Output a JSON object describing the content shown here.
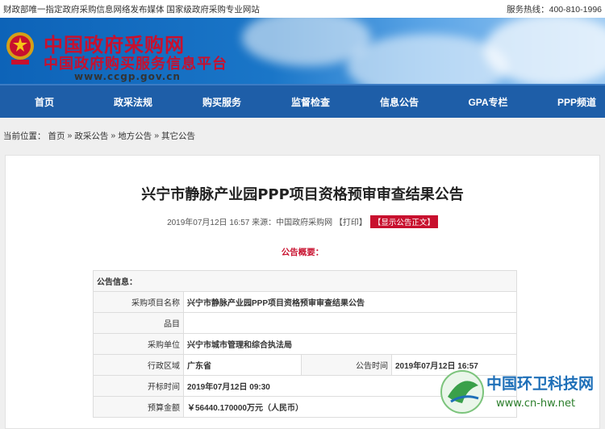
{
  "topbar": {
    "left": "财政部唯一指定政府采购信息网络发布媒体 国家级政府采购专业网站",
    "right": "服务热线：400-810-1996"
  },
  "banner": {
    "line1": "中国政府采购网",
    "line2": "中国政府购买服务信息平台",
    "url": "www.ccgp.gov.cn"
  },
  "nav": [
    "首页",
    "政采法规",
    "购买服务",
    "监督检查",
    "信息公告",
    "GPA专栏",
    "PPP频道"
  ],
  "crumbs": {
    "prefix": "当前位置：",
    "items": [
      "首页",
      "政采公告",
      "地方公告",
      "其它公告"
    ],
    "sep": "»"
  },
  "article": {
    "title": "兴宁市静脉产业园PPP项目资格预审审查结果公告",
    "meta": "2019年07月12日 16:57 来源：中国政府采购网 【打印】",
    "show_body": "【显示公告正文】",
    "summary": "公告概要："
  },
  "table": {
    "header": "公告信息：",
    "rows": [
      {
        "label": "采购项目名称",
        "value": "兴宁市静脉产业园PPP项目资格预审审查结果公告"
      },
      {
        "label": "品目",
        "value": ""
      },
      {
        "label": "采购单位",
        "value": "兴宁市城市管理和综合执法局"
      },
      {
        "label": "行政区域",
        "value": "广东省",
        "label2": "公告时间",
        "value2": "2019年07月12日 16:57"
      },
      {
        "label": "开标时间",
        "value": "2019年07月12日 09:30"
      },
      {
        "label": "预算金额",
        "value": "￥56440.170000万元（人民币）"
      }
    ]
  },
  "watermark": {
    "title": "中国环卫科技网",
    "url": "www.cn-hw.net"
  }
}
